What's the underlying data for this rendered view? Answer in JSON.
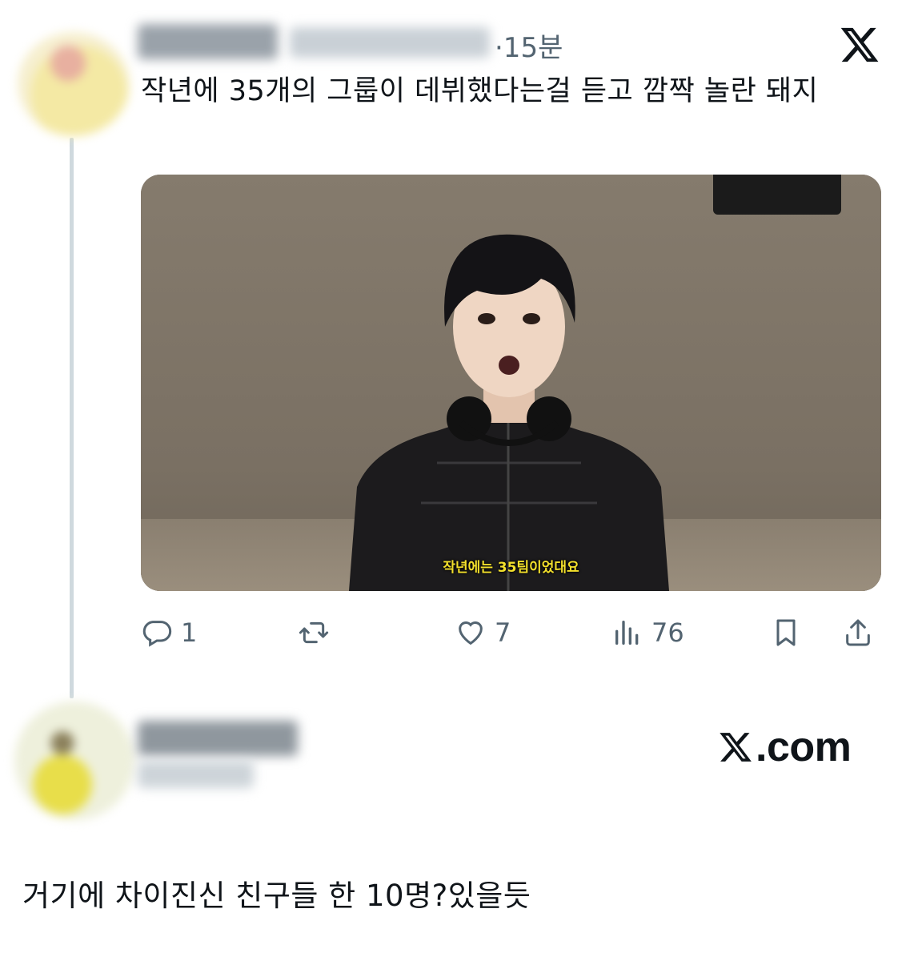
{
  "post": {
    "timestamp": "·15분",
    "text": "작년에 35개의 그룹이 데뷔했다는걸 듣고 깜짝 놀란 돼지",
    "media": {
      "subtitle": "작년에는 35팀이었대요"
    },
    "actions": {
      "reply_count": "1",
      "retweet_count": "",
      "like_count": "7",
      "view_count": "76"
    }
  },
  "brand": {
    "logo_text": ".com"
  },
  "reply": {
    "text": "거기에 차이진신 친구들 한 10명?있을듯"
  },
  "icons": {
    "reply": "reply-icon",
    "retweet": "retweet-icon",
    "like": "heart-icon",
    "views": "views-icon",
    "bookmark": "bookmark-icon",
    "share": "share-icon",
    "logo": "x-logo-icon"
  },
  "colors": {
    "text": "#0f1419",
    "muted": "#536471",
    "thread_line": "#cfd9de",
    "subtitle": "#f3e02c"
  }
}
